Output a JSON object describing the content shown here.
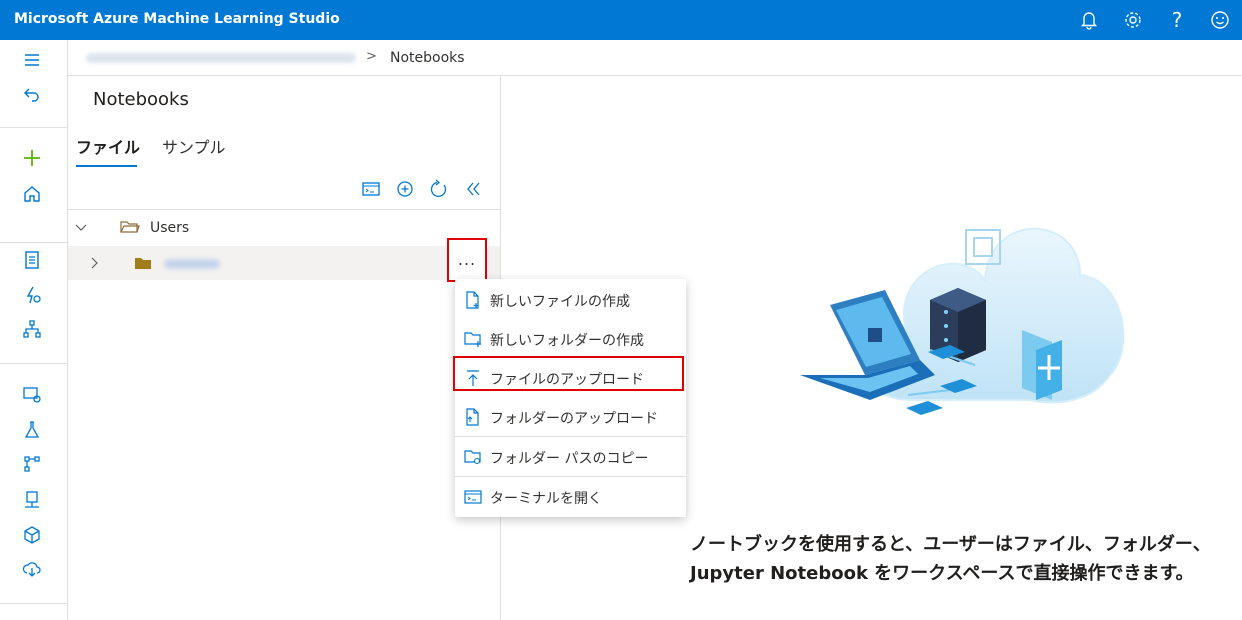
{
  "app": {
    "title": "Microsoft Azure Machine Learning Studio"
  },
  "topbar": {
    "icons": [
      "bell-icon",
      "gear-icon",
      "help-icon",
      "smiley-icon"
    ],
    "help_glyph": "?"
  },
  "leftnav": {
    "icons": [
      "hamburger-icon",
      "back-icon",
      "plus-icon",
      "home-icon",
      "notebook-icon",
      "automl-icon",
      "designer-icon",
      "datasets-icon",
      "experiments-icon",
      "pipelines-icon",
      "models-icon",
      "endpoints-icon",
      "compute-icon"
    ]
  },
  "breadcrumb": {
    "separator": ">",
    "current": "Notebooks"
  },
  "panel": {
    "title": "Notebooks",
    "tabs": [
      {
        "label": "ファイル",
        "active": true
      },
      {
        "label": "サンプル",
        "active": false
      }
    ],
    "toolbar_icons": [
      "terminal-icon",
      "add-circle-icon",
      "refresh-icon",
      "collapse-icon"
    ],
    "tree": {
      "root_label": "Users",
      "more_label": "..."
    }
  },
  "menu": {
    "items": [
      {
        "label": "新しいファイルの作成",
        "icon": "new-file-icon"
      },
      {
        "label": "新しいフォルダーの作成",
        "icon": "new-folder-icon"
      },
      {
        "label": "ファイルのアップロード",
        "icon": "upload-icon",
        "highlighted": true
      },
      {
        "label": "フォルダーのアップロード",
        "icon": "upload-folder-icon"
      },
      {
        "label": "フォルダー パスのコピー",
        "icon": "copy-path-icon"
      },
      {
        "label": "ターミナルを開く",
        "icon": "terminal-icon"
      }
    ]
  },
  "main": {
    "description": "ノートブックを使用すると、ユーザーはファイル、フォルダー、Jupyter Notebook をワークスペースで直接操作できます。"
  },
  "colors": {
    "accent": "#0078d4",
    "highlight": "#e00000",
    "nav_green": "#5db300"
  }
}
